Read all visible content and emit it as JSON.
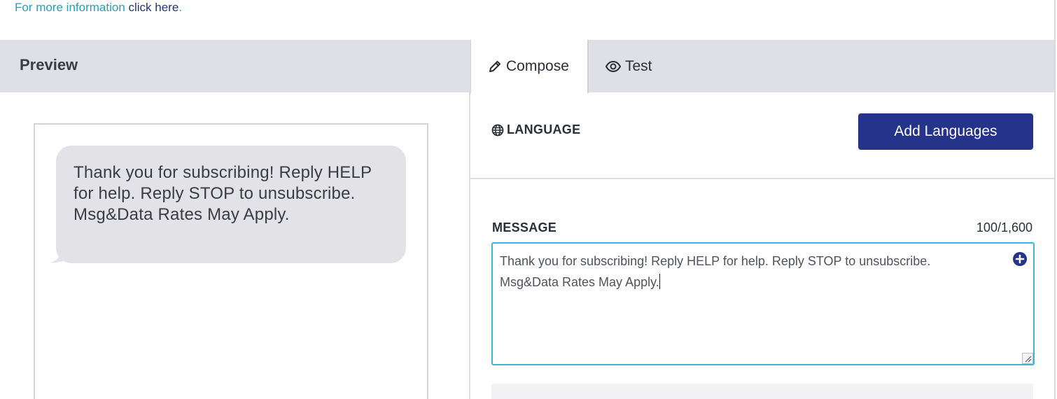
{
  "info": {
    "text": "For more information ",
    "link": "click here",
    "suffix": "."
  },
  "preview": {
    "title": "Preview",
    "message": "Thank you for subscribing! Reply HELP for help. Reply STOP to unsubscribe. Msg&Data Rates May Apply."
  },
  "tabs": [
    {
      "label": "Compose",
      "icon": "pencil-icon",
      "active": true
    },
    {
      "label": "Test",
      "icon": "eye-icon",
      "active": false
    }
  ],
  "language": {
    "label": "LANGUAGE",
    "icon": "globe-icon",
    "add_button": "Add Languages"
  },
  "message": {
    "label": "MESSAGE",
    "count": "100/1,600",
    "line1": "Thank you for subscribing! Reply HELP for help. Reply STOP to unsubscribe.",
    "line2": "Msg&Data Rates May Apply.",
    "insert_icon": "plus-circle-icon"
  },
  "colors": {
    "primary": "#25338a",
    "focus": "#3ab8d6",
    "link": "#2a9db3"
  }
}
